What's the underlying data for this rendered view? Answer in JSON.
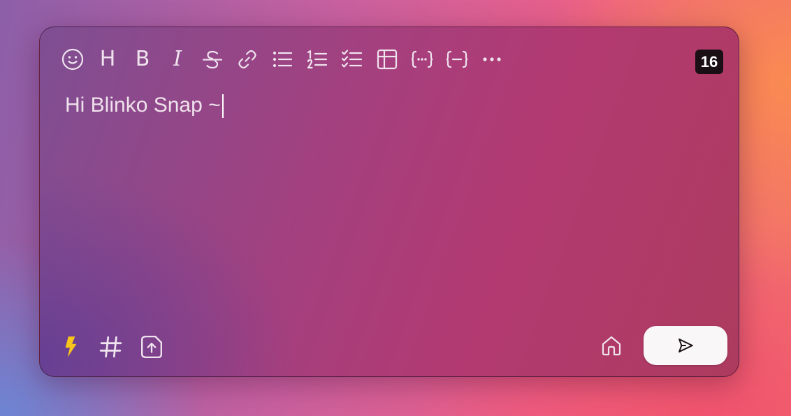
{
  "toolbar": {
    "icons": [
      "emoji-icon",
      "heading-icon",
      "bold-icon",
      "italic-icon",
      "strikethrough-icon",
      "link-icon",
      "bullet-list-icon",
      "ordered-list-icon",
      "task-list-icon",
      "table-icon",
      "inline-code-icon",
      "code-block-icon",
      "more-icon"
    ],
    "heading_label": "H",
    "bold_label": "B",
    "italic_label": "I"
  },
  "word_count": "16",
  "editor": {
    "text": "Hi Blinko Snap ~"
  },
  "colors": {
    "icon": "#efe3ee",
    "flash": "#f7c51c",
    "badge_bg": "#1a0f15",
    "send_bg": "#faf7f8"
  },
  "bottom": {
    "icons": [
      "flash-icon",
      "hashtag-icon",
      "upload-file-icon",
      "home-icon",
      "send-icon"
    ]
  }
}
